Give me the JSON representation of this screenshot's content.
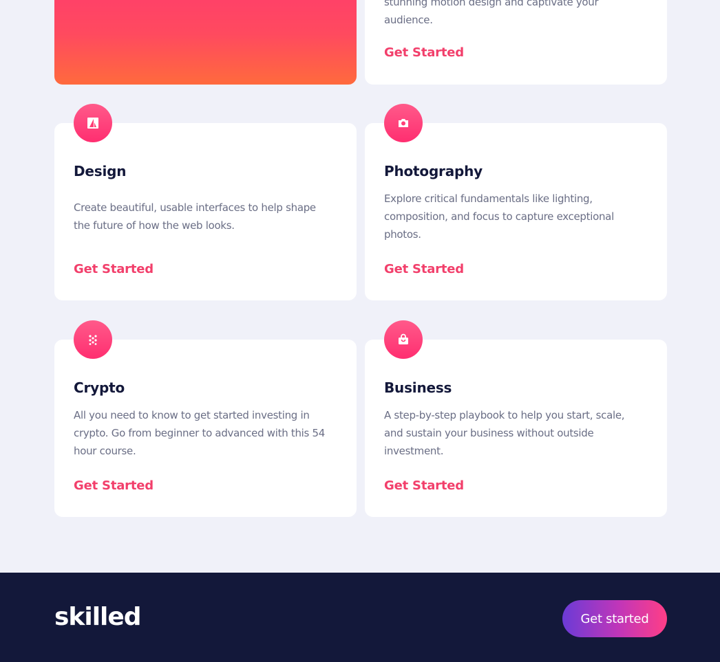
{
  "hero": {
    "desc_lines": [
      "stunning motion design and captivate your",
      "audience."
    ],
    "cta": "Get Started"
  },
  "courses": [
    {
      "title": "Design",
      "icon": "design-icon",
      "desc_lines": [
        "Create beautiful, usable interfaces to help shape",
        "the future of how the web looks."
      ],
      "cta": "Get Started"
    },
    {
      "title": "Photography",
      "icon": "camera-icon",
      "desc_lines": [
        "Explore critical fundamentals like lighting,",
        "composition, and focus to capture exceptional",
        "photos."
      ],
      "cta": "Get Started"
    },
    {
      "title": "Crypto",
      "icon": "crypto-icon",
      "desc_lines": [
        "All you need to know to get started investing in",
        "crypto. Go from beginner to advanced with this 54",
        "hour course."
      ],
      "cta": "Get Started"
    },
    {
      "title": "Business",
      "icon": "shopping-bag-icon",
      "desc_lines": [
        "A step-by-step playbook to help you start, scale,",
        "and sustain your business without outside",
        "investment."
      ],
      "cta": "Get Started"
    }
  ],
  "footer": {
    "logo": "skilled",
    "cta": "Get started"
  },
  "colors": {
    "background": "#f0f1f9",
    "accent": "#f23f6b",
    "footer_bg": "#13183a",
    "title": "#13183a",
    "body_text": "#6a6e85"
  }
}
